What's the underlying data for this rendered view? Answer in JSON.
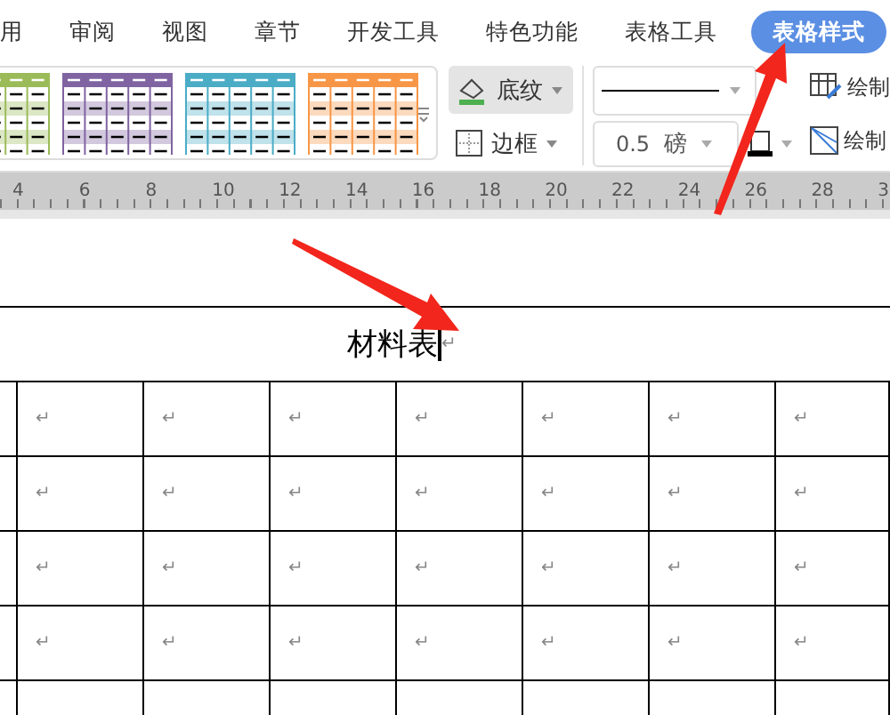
{
  "tabs": [
    {
      "label": "用",
      "selected": false
    },
    {
      "label": "审阅",
      "selected": false
    },
    {
      "label": "视图",
      "selected": false
    },
    {
      "label": "章节",
      "selected": false
    },
    {
      "label": "开发工具",
      "selected": false
    },
    {
      "label": "特色功能",
      "selected": false
    },
    {
      "label": "表格工具",
      "selected": false
    },
    {
      "label": "表格样式",
      "selected": true
    }
  ],
  "ribbon": {
    "table_styles": [
      {
        "color": "#9bbb59"
      },
      {
        "color": "#8064a2"
      },
      {
        "color": "#4bacc6"
      },
      {
        "color": "#f79646"
      }
    ],
    "shading_button": {
      "label": "底纹",
      "pressed": true
    },
    "border_button": {
      "label": "边框"
    },
    "line_width": {
      "value": "0.5",
      "unit": "磅"
    },
    "draw_buttons": [
      "绘制",
      "绘制"
    ]
  },
  "ruler": {
    "ticks": [
      "4",
      "6",
      "8",
      "10",
      "12",
      "14",
      "16",
      "18",
      "20",
      "22",
      "24",
      "26",
      "28",
      "3"
    ]
  },
  "table": {
    "title": "材料表",
    "title_mark": "↵",
    "rows": [
      [
        "↵",
        "↵",
        "↵",
        "↵",
        "↵",
        "↵",
        "↵"
      ],
      [
        "↵",
        "↵",
        "↵",
        "↵",
        "↵",
        "↵",
        "↵"
      ],
      [
        "↵",
        "↵",
        "↵",
        "↵",
        "↵",
        "↵",
        "↵"
      ],
      [
        "↵",
        "↵",
        "↵",
        "↵",
        "↵",
        "↵",
        "↵"
      ]
    ]
  }
}
